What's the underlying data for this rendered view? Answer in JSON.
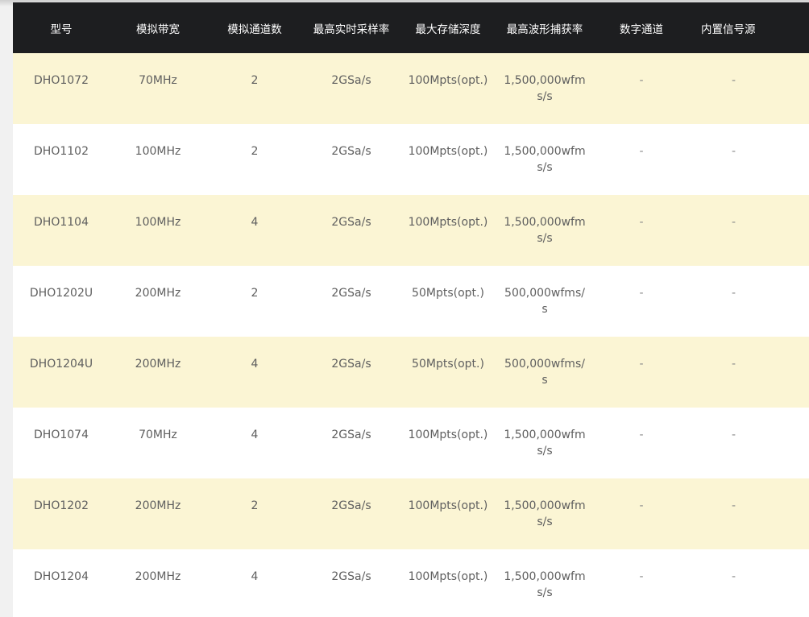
{
  "table": {
    "headers": [
      "型号",
      "模拟带宽",
      "模拟通道数",
      "最高实时采样率",
      "最大存储深度",
      "最高波形捕获率",
      "数字通道",
      "内置信号源"
    ],
    "rows": [
      [
        "DHO1072",
        "70MHz",
        "2",
        "2GSa/s",
        "100Mpts(opt.)",
        "1,500,000wfms/s",
        "-",
        "-"
      ],
      [
        "DHO1102",
        "100MHz",
        "2",
        "2GSa/s",
        "100Mpts(opt.)",
        "1,500,000wfms/s",
        "-",
        "-"
      ],
      [
        "DHO1104",
        "100MHz",
        "4",
        "2GSa/s",
        "100Mpts(opt.)",
        "1,500,000wfms/s",
        "-",
        "-"
      ],
      [
        "DHO1202U",
        "200MHz",
        "2",
        "2GSa/s",
        "50Mpts(opt.)",
        "500,000wfms/s",
        "-",
        "-"
      ],
      [
        "DHO1204U",
        "200MHz",
        "4",
        "2GSa/s",
        "50Mpts(opt.)",
        "500,000wfms/s",
        "-",
        "-"
      ],
      [
        "DHO1074",
        "70MHz",
        "4",
        "2GSa/s",
        "100Mpts(opt.)",
        "1,500,000wfms/s",
        "-",
        "-"
      ],
      [
        "DHO1202",
        "200MHz",
        "2",
        "2GSa/s",
        "100Mpts(opt.)",
        "1,500,000wfms/s",
        "-",
        "-"
      ],
      [
        "DHO1204",
        "200MHz",
        "4",
        "2GSa/s",
        "100Mpts(opt.)",
        "1,500,000wfms/s",
        "-",
        "-"
      ]
    ]
  },
  "colors": {
    "header_bg": "#1d1e20",
    "row_odd_bg": "#fbf5d4",
    "row_even_bg": "#ffffff",
    "text": "#5f5f5f"
  }
}
